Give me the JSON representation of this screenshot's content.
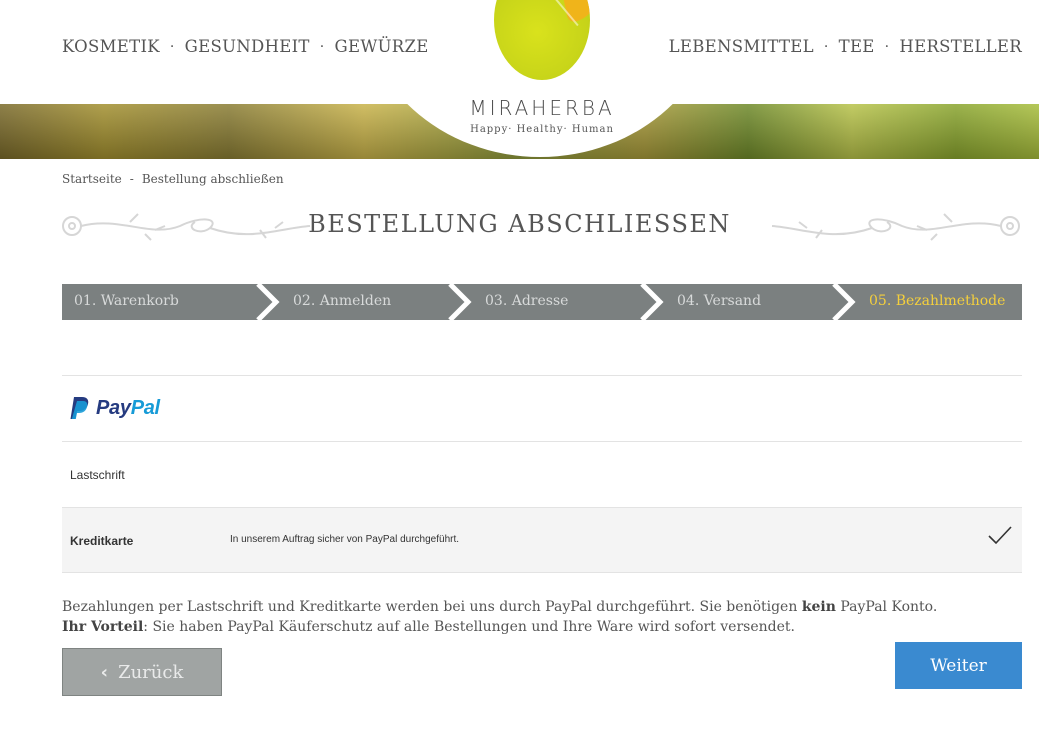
{
  "nav": {
    "left": [
      "KOSMETIK",
      "GESUNDHEIT",
      "GEWÜRZE"
    ],
    "right": [
      "LEBENSMITTEL",
      "TEE",
      "HERSTELLER"
    ],
    "separator": "·"
  },
  "brand": {
    "name": "MIRAHERBA",
    "tagline": "Happy· Healthy· Human"
  },
  "breadcrumb": {
    "home": "Startseite",
    "separator": "-",
    "current": "Bestellung abschließen"
  },
  "page_title": "BESTELLUNG ABSCHLIESSEN",
  "steps": {
    "items": [
      {
        "label": "01. Warenkorb"
      },
      {
        "label": "02. Anmelden"
      },
      {
        "label": "03. Adresse"
      },
      {
        "label": "04. Versand"
      },
      {
        "label": "05. Bezahlmethode"
      }
    ],
    "active_index": 4,
    "active_color": "#f4cf3c"
  },
  "payment": {
    "paypal": {
      "logo_text_1": "Pay",
      "logo_text_2": "Pal"
    },
    "lastschrift": {
      "label": "Lastschrift"
    },
    "kreditkarte": {
      "label": "Kreditkarte",
      "description": "In unserem Auftrag sicher von PayPal durchgeführt.",
      "selected": true
    }
  },
  "info": {
    "line1_pre": "Bezahlungen per Lastschrift und Kreditkarte werden bei uns durch PayPal durchgeführt. Sie benötigen ",
    "line1_bold": "kein",
    "line1_post": " PayPal Konto.",
    "line2_bold": "Ihr Vorteil",
    "line2_post": ": Sie haben PayPal Käuferschutz auf alle Bestellungen und Ihre Ware wird sofort versendet."
  },
  "buttons": {
    "back": "Zurück",
    "next": "Weiter"
  },
  "colors": {
    "steps_bar": "#7b8080",
    "next_button": "#3a8ad0",
    "back_button": "#a0a4a3",
    "paypal_dark": "#253b80",
    "paypal_light": "#179bd7"
  }
}
